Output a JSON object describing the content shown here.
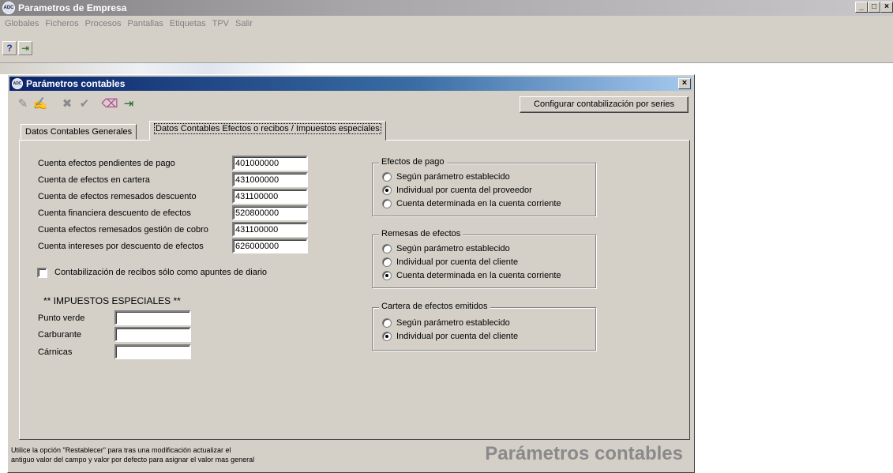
{
  "app": {
    "title": "Parametros de Empresa",
    "icon_text": "ADC",
    "window_buttons": [
      "_",
      "□",
      "×"
    ],
    "menu": [
      "Globales",
      "Ficheros",
      "Procesos",
      "Pantallas",
      "Etiquetas",
      "TPV",
      "Salir"
    ],
    "toolbar": [
      {
        "icon": "help-icon",
        "glyph": "?"
      },
      {
        "icon": "exit-door-icon",
        "glyph": "⇥"
      }
    ]
  },
  "dialog": {
    "title": "Parámetros contables",
    "close_label": "×",
    "toolbar": [
      {
        "icon": "save-icon",
        "glyph": "✎"
      },
      {
        "icon": "edit-icon",
        "glyph": "✍"
      },
      {
        "icon": "cancel-icon",
        "glyph": "✖"
      },
      {
        "icon": "accept-icon",
        "glyph": "✔"
      },
      {
        "icon": "eraser-icon",
        "glyph": "⌫"
      },
      {
        "icon": "exit-door-icon",
        "glyph": "⇥"
      }
    ],
    "config_button": "Configurar contabilización por series",
    "tabs": [
      {
        "label": "Datos Contables Generales",
        "active": false
      },
      {
        "label": "Datos Contables Efectos o recibos / Impuestos especiales",
        "active": true
      }
    ],
    "accounts": [
      {
        "label": "Cuenta efectos pendientes de pago",
        "value": "401000000"
      },
      {
        "label": "Cuenta de efectos en cartera",
        "value": "431000000"
      },
      {
        "label": "Cuenta de efectos remesados descuento",
        "value": "431100000"
      },
      {
        "label": "Cuenta financiera descuento de efectos",
        "value": "520800000"
      },
      {
        "label": "Cuenta efectos remesados gestión de cobro",
        "value": "431100000"
      },
      {
        "label": "Cuenta intereses por descuento de efectos",
        "value": "626000000"
      }
    ],
    "checkbox": {
      "label": "Contabilización de recibos sólo como apuntes de diario",
      "checked": false
    },
    "impuestos": {
      "heading": "** IMPUESTOS ESPECIALES **",
      "fields": [
        {
          "label": "Punto verde",
          "value": ""
        },
        {
          "label": "Carburante",
          "value": ""
        },
        {
          "label": "Cárnicas",
          "value": ""
        }
      ]
    },
    "groups": [
      {
        "title": "Efectos de pago",
        "options": [
          {
            "label": "Según parámetro establecido",
            "selected": false
          },
          {
            "label": "Individual por cuenta del proveedor",
            "selected": true
          },
          {
            "label": "Cuenta determinada en la cuenta corriente",
            "selected": false
          }
        ]
      },
      {
        "title": "Remesas de efectos",
        "options": [
          {
            "label": "Según parámetro establecido",
            "selected": false
          },
          {
            "label": "Individual por cuenta del cliente",
            "selected": false
          },
          {
            "label": "Cuenta determinada en la cuenta corriente",
            "selected": true
          }
        ]
      },
      {
        "title": "Cartera de efectos emitidos",
        "options": [
          {
            "label": "Según parámetro establecido",
            "selected": false
          },
          {
            "label": "Individual por cuenta del cliente",
            "selected": true
          }
        ]
      }
    ],
    "hint_line1": "Utilice la opción \"Restablecer\" para tras una modificación actualizar el",
    "hint_line2": "antiguo valor del campo y valor por defecto para asignar el valor mas general",
    "footer_title": "Parámetros contables"
  }
}
